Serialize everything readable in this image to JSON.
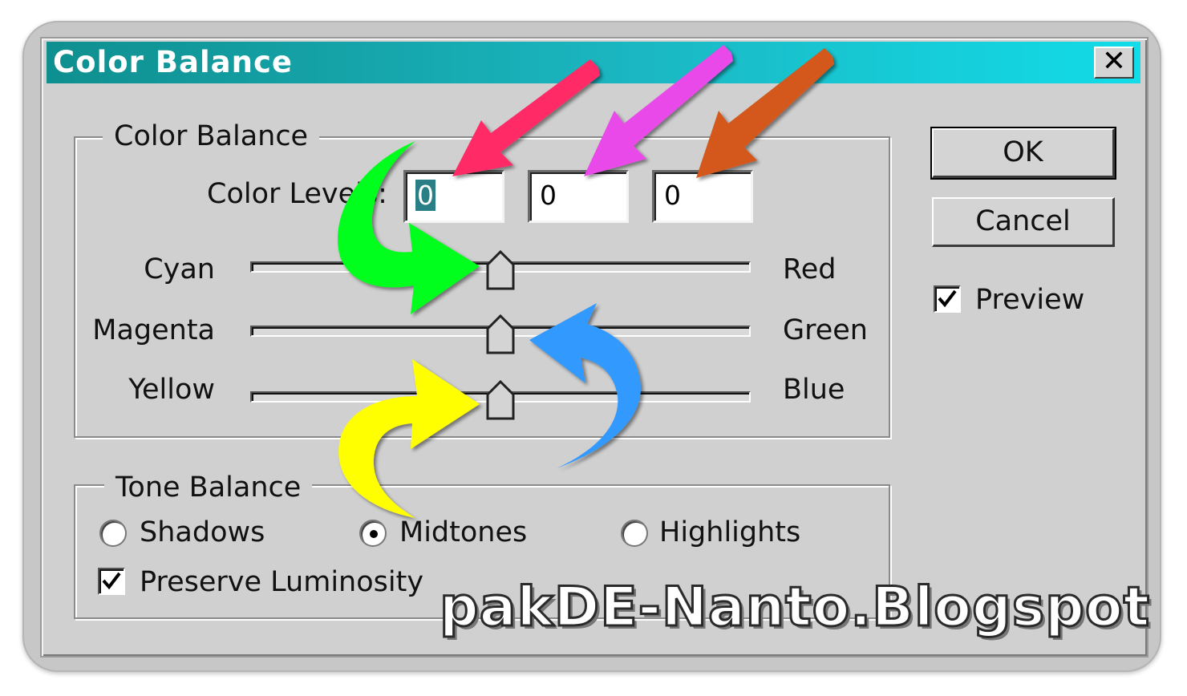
{
  "window": {
    "title": "Color Balance",
    "close_glyph": "✕"
  },
  "color_balance_group": {
    "legend": "Color Balance",
    "color_levels_label": "Color Levels:",
    "levels": [
      "0",
      "0",
      "0"
    ],
    "sliders": [
      {
        "left": "Cyan",
        "right": "Red",
        "value": 0
      },
      {
        "left": "Magenta",
        "right": "Green",
        "value": 0
      },
      {
        "left": "Yellow",
        "right": "Blue",
        "value": 0
      }
    ]
  },
  "tone_balance_group": {
    "legend": "Tone Balance",
    "options": [
      "Shadows",
      "Midtones",
      "Highlights"
    ],
    "selected": "Midtones",
    "preserve_luminosity_label": "Preserve Luminosity",
    "preserve_luminosity_checked": true
  },
  "buttons": {
    "ok": "OK",
    "cancel": "Cancel"
  },
  "preview": {
    "label": "Preview",
    "checked": true
  },
  "annotations": {
    "arrow_colors": [
      "#ff2a66",
      "#e84ae8",
      "#d4581c"
    ],
    "curve_colors": [
      "#00ff1e",
      "#3399ff",
      "#ffff00"
    ]
  },
  "watermark": "pakDE-Nanto.Blogspot"
}
